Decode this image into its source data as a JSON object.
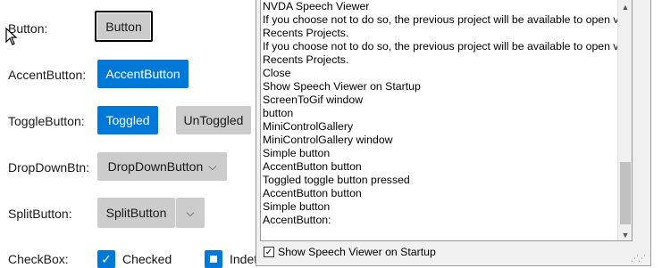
{
  "rows": {
    "button": {
      "label": "Button:",
      "button": "Button"
    },
    "accent": {
      "label": "AccentButton:",
      "button": "AccentButton"
    },
    "toggle": {
      "label": "ToggleButton:",
      "toggled": "Toggled",
      "untoggled": "UnToggled"
    },
    "dropdown": {
      "label": "DropDownBtn:",
      "button": "DropDownButton"
    },
    "split": {
      "label": "SplitButton:",
      "button": "SplitButton"
    },
    "checkbox": {
      "label": "CheckBox:",
      "checked": "Checked",
      "indeterminate": "Indet"
    }
  },
  "icons": {
    "chevron": "⌵",
    "check": "✓"
  },
  "colors": {
    "accent": "#0078d7",
    "gray_button": "#cccccc"
  },
  "speech_viewer": {
    "lines": [
      "NVDA Speech Viewer",
      "If you choose not to do so, the previous project will be available to open via",
      "Recents Projects.",
      "If you choose not to do so, the previous project will be available to open via",
      "Recents Projects.",
      "Close",
      "Show Speech Viewer on Startup",
      "ScreenToGif  window",
      "button",
      "MiniControlGallery",
      "MiniControlGallery  window",
      "Simple  button",
      "AccentButton  button",
      "Toggled  toggle button  pressed",
      "AccentButton  button",
      "Simple  button",
      "AccentButton:"
    ],
    "startup_checkbox_label": "Show Speech Viewer on Startup",
    "startup_checked": true
  }
}
